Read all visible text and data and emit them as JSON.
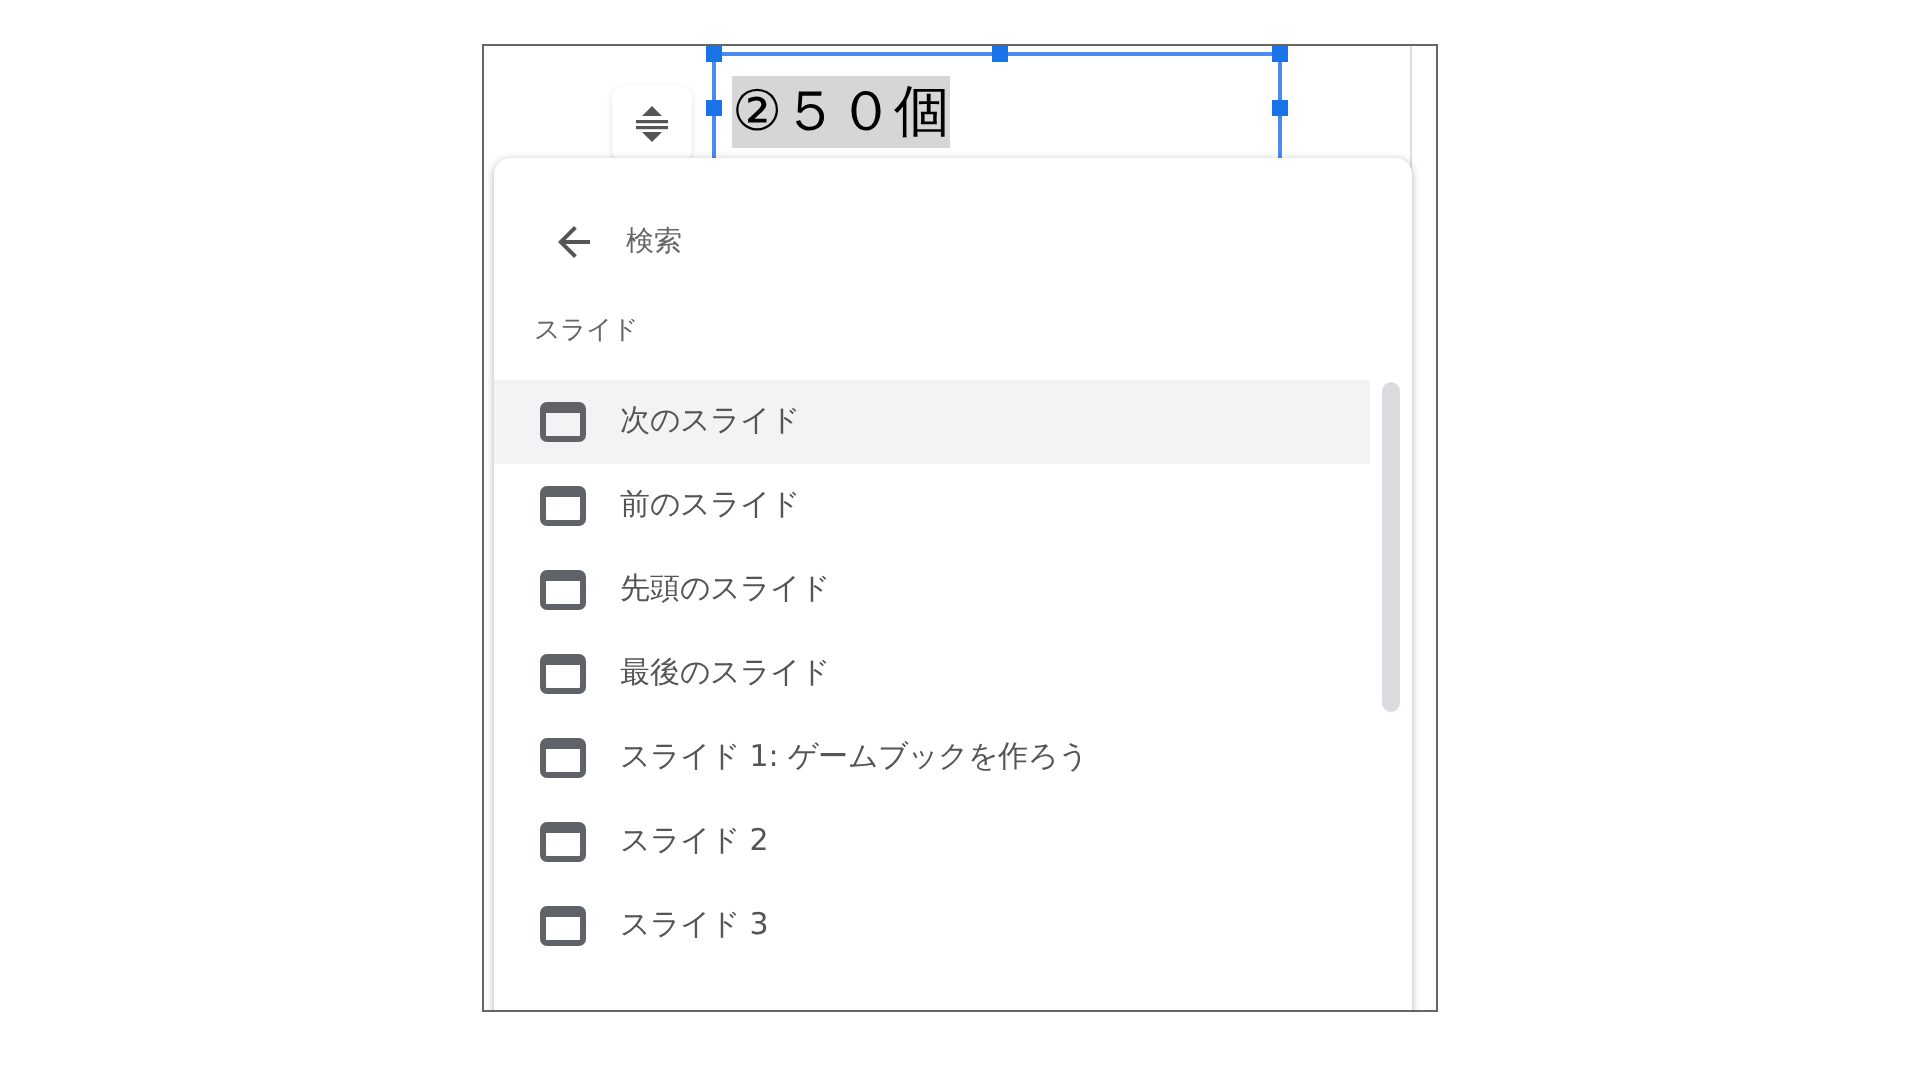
{
  "text_box": {
    "text": "②５０個",
    "selected": true
  },
  "menu": {
    "back_label": "検索",
    "section_label": "スライド",
    "items": [
      {
        "label": "次のスライド",
        "selected": true
      },
      {
        "label": "前のスライド",
        "selected": false
      },
      {
        "label": "先頭のスライド",
        "selected": false
      },
      {
        "label": "最後のスライド",
        "selected": false
      },
      {
        "label": "スライド 1: ゲームブックを作ろう",
        "selected": false
      },
      {
        "label": "スライド 2",
        "selected": false
      },
      {
        "label": "スライド 3",
        "selected": false
      }
    ]
  }
}
